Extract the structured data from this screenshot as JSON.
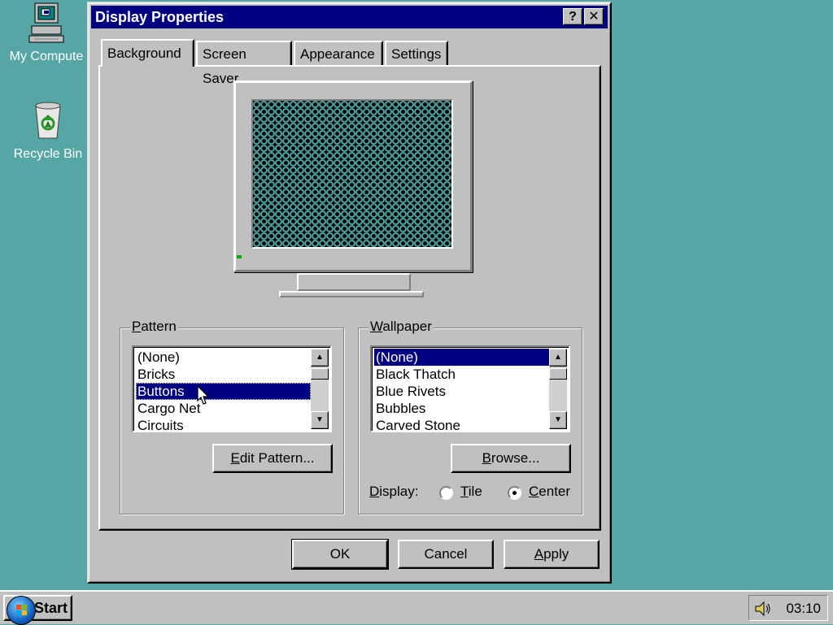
{
  "desktop": {
    "icons": [
      {
        "label": "My Compute",
        "icon": "my-computer-icon"
      },
      {
        "label": "Recycle Bin",
        "icon": "recycle-bin-icon"
      }
    ]
  },
  "window": {
    "title": "Display Properties",
    "help_glyph": "?",
    "close_glyph": "✕"
  },
  "tabs": [
    {
      "label": "Background",
      "active": true
    },
    {
      "label": "Screen Saver",
      "active": false
    },
    {
      "label": "Appearance",
      "active": false
    },
    {
      "label": "Settings",
      "active": false
    }
  ],
  "pattern": {
    "legend_first": "P",
    "legend_rest": "attern",
    "items": [
      "(None)",
      "Bricks",
      "Buttons",
      "Cargo Net",
      "Circuits"
    ],
    "selected": "Buttons",
    "edit_first": "E",
    "edit_rest": "dit Pattern..."
  },
  "wallpaper": {
    "legend_first": "W",
    "legend_rest": "allpaper",
    "items": [
      "(None)",
      "Black Thatch",
      "Blue Rivets",
      "Bubbles",
      "Carved Stone"
    ],
    "selected": "(None)",
    "browse_first": "B",
    "browse_rest": "rowse...",
    "display_first": "D",
    "display_rest": "isplay:",
    "tile_first": "T",
    "tile_rest": "ile",
    "center_first": "C",
    "center_rest": "enter",
    "selected_display": "Center"
  },
  "buttons": {
    "ok": "OK",
    "cancel": "Cancel",
    "apply_first": "A",
    "apply_rest": "pply"
  },
  "taskbar": {
    "start_label": "Start",
    "clock": "03:10"
  },
  "colors": {
    "desktop": "#56a6a6",
    "titlebar": "#000080",
    "selection": "#000080",
    "face": "#c0c0c0"
  }
}
